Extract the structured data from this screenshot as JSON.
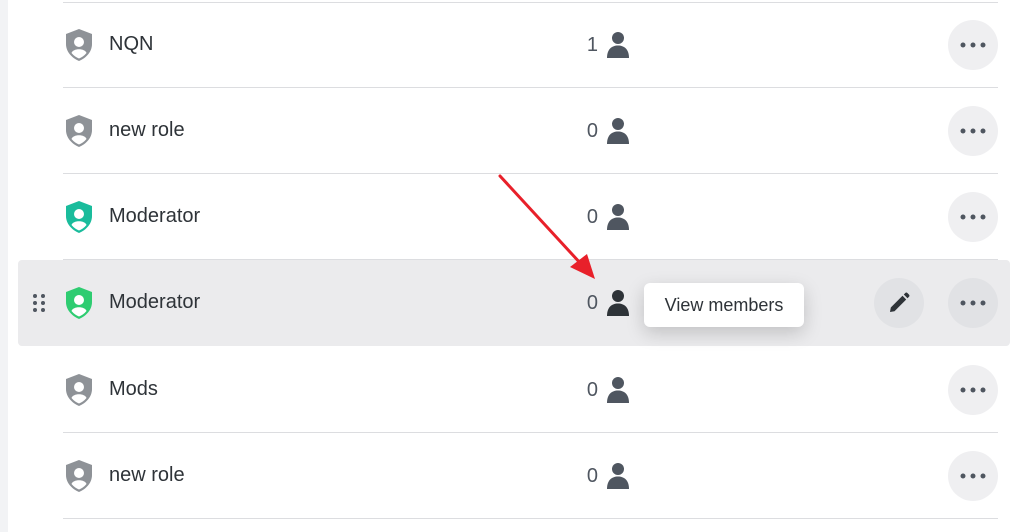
{
  "colors": {
    "default_role_shield": "#8e9297",
    "moderator_shield": "#1abc9c",
    "hover_moderator_shield": "#2ecc71",
    "arrow": "#e8202a"
  },
  "roles": [
    {
      "name": "NQN",
      "member_count": "1",
      "icon": "shield-user-icon",
      "color": "#8e9297"
    },
    {
      "name": "new role",
      "member_count": "0",
      "icon": "shield-user-icon",
      "color": "#8e9297"
    },
    {
      "name": "Moderator",
      "member_count": "0",
      "icon": "shield-user-icon",
      "color": "#1abc9c"
    },
    {
      "name": "Moderator",
      "member_count": "0",
      "icon": "shield-user-icon",
      "color": "#2ecc71",
      "hovered": true
    },
    {
      "name": "Mods",
      "member_count": "0",
      "icon": "shield-user-icon",
      "color": "#8e9297"
    },
    {
      "name": "new role",
      "member_count": "0",
      "icon": "shield-user-icon",
      "color": "#8e9297"
    }
  ],
  "tooltip": {
    "text": "View members"
  },
  "icons": {
    "drag": "drag-handle-icon",
    "members": "person-icon",
    "edit": "pencil-icon",
    "more": "more-horizontal-icon"
  }
}
